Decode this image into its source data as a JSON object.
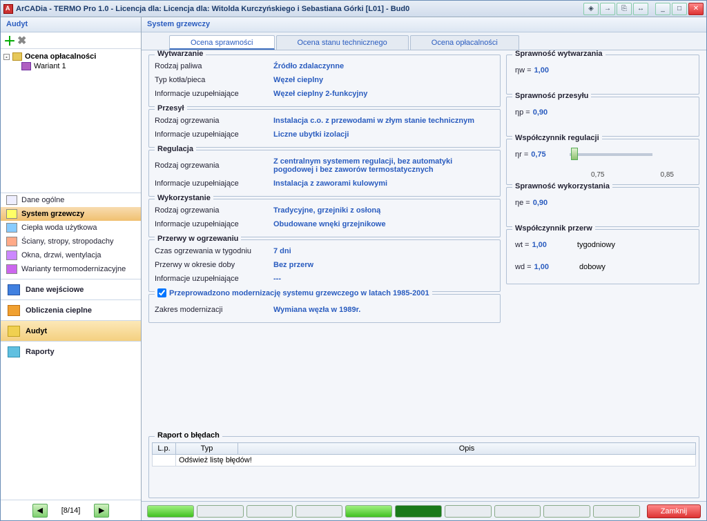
{
  "titlebar": {
    "text": "ArCADia - TERMO Pro 1.0 - Licencja dla: Licencja dla: Witolda Kurczyńskiego i Sebastiana Górki [L01] - Bud0"
  },
  "left": {
    "header": "Audyt",
    "tree": {
      "root_label": "Ocena opłacalności",
      "child_label": "Wariant 1"
    },
    "nav_small": [
      "Dane ogólne",
      "System grzewczy",
      "Ciepła woda użytkowa",
      "Ściany, stropy, stropodachy",
      "Okna, drzwi, wentylacja",
      "Warianty termomodernizacyjne"
    ],
    "nav_selected_index": 1,
    "nav_big": [
      "Dane wejściowe",
      "Obliczenia cieplne",
      "Audyt",
      "Raporty"
    ],
    "nav_big_selected_index": 2,
    "pager": "[8/14]"
  },
  "right": {
    "header": "System grzewczy",
    "tabs": [
      "Ocena sprawności",
      "Ocena stanu technicznego",
      "Ocena opłacalności"
    ],
    "tab_active_index": 0,
    "groups": {
      "wytwarzanie": {
        "title": "Wytwarzanie",
        "rows": [
          {
            "label": "Rodzaj paliwa",
            "value": "Źródło zdalaczynne"
          },
          {
            "label": "Typ kotła/pieca",
            "value": "Węzeł cieplny"
          },
          {
            "label": "Informacje uzupełniające",
            "value": "Węzeł cieplny 2-funkcyjny"
          }
        ]
      },
      "przesyl": {
        "title": "Przesył",
        "rows": [
          {
            "label": "Rodzaj ogrzewania",
            "value": "Instalacja c.o. z przewodami w złym stanie technicznym"
          },
          {
            "label": "Informacje uzupełniające",
            "value": "Liczne ubytki izolacji"
          }
        ]
      },
      "regulacja": {
        "title": "Regulacja",
        "rows": [
          {
            "label": "Rodzaj ogrzewania",
            "value": "Z centralnym systemem regulacji, bez automatyki pogodowej i bez zaworów termostatycznych"
          },
          {
            "label": "Informacje uzupełniające",
            "value": "Instalacja z zaworami kulowymi"
          }
        ]
      },
      "wykorzystanie": {
        "title": "Wykorzystanie",
        "rows": [
          {
            "label": "Rodzaj ogrzewania",
            "value": "Tradycyjne, grzejniki z osłoną"
          },
          {
            "label": "Informacje uzupełniające",
            "value": "Obudowane wnęki grzejnikowe"
          }
        ]
      },
      "przerwy": {
        "title": "Przerwy w ogrzewaniu",
        "rows": [
          {
            "label": "Czas ogrzewania w tygodniu",
            "value": "7 dni"
          },
          {
            "label": "Przerwy w okresie doby",
            "value": "Bez przerw"
          },
          {
            "label": "Informacje uzupełniające",
            "value": "---"
          }
        ]
      },
      "modern": {
        "check_label": "Przeprowadzono modernizację systemu grzewczego w latach 1985-2001",
        "row": {
          "label": "Zakres modernizacji",
          "value": "Wymiana węzła w 1989r."
        }
      },
      "eff_wytw": {
        "title": "Sprawność wytwarzania",
        "sym": "ηw =",
        "val": "1,00"
      },
      "eff_przes": {
        "title": "Sprawność przesyłu",
        "sym": "ηp =",
        "val": "0,90"
      },
      "eff_reg": {
        "title": "Współczynnik regulacji",
        "sym": "ηr =",
        "val": "0,75",
        "tick_l": "0,75",
        "tick_r": "0,85"
      },
      "eff_wyk": {
        "title": "Sprawność wykorzystania",
        "sym": "ηe =",
        "val": "0,90"
      },
      "eff_prz": {
        "title": "Współczynnik przerw",
        "r1": {
          "sym": "wt =",
          "val": "1,00",
          "lbl": "tygodniowy"
        },
        "r2": {
          "sym": "wd =",
          "val": "1,00",
          "lbl": "dobowy"
        }
      }
    },
    "errors": {
      "title": "Raport o błędach",
      "cols": {
        "lp": "L.p.",
        "typ": "Typ",
        "opis": "Opis"
      },
      "msg": "Odśwież listę błędów!"
    },
    "close_btn": "Zamknij"
  }
}
